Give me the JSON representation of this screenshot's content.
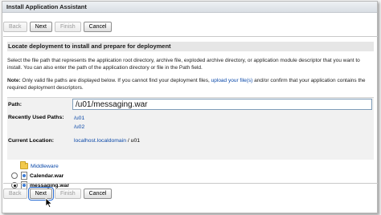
{
  "window": {
    "title": "Install Application Assistant"
  },
  "nav_buttons": {
    "back": "Back",
    "next": "Next",
    "finish": "Finish",
    "cancel": "Cancel"
  },
  "section": {
    "header": "Locate deployment to install and prepare for deployment",
    "description": "Select the file path that represents the application root directory, archive file, exploded archive directory, or application module descriptor that you want to install. You can also enter the path of the application directory or file in the Path field.",
    "note_label": "Note:",
    "note_text_before": " Only valid file paths are displayed below. If you cannot find your deployment files, ",
    "note_link": "upload your file(s)",
    "note_text_after": " and/or confirm that your application contains the required deployment descriptors."
  },
  "form": {
    "path_label": "Path:",
    "path_value": "/u01/messaging.war",
    "recent_label": "Recently Used Paths:",
    "recent_paths": [
      "/u01",
      "/u02"
    ],
    "current_label": "Current Location:",
    "current_host": "localhost.localdomain",
    "current_separator": " / ",
    "current_dir": "u01"
  },
  "file_tree": {
    "folder": {
      "name": "Middleware",
      "icon": "folder-icon"
    },
    "files": [
      {
        "name": "Calendar.war",
        "selected": false
      },
      {
        "name": "messaging.war",
        "selected": true
      }
    ]
  },
  "colors": {
    "link": "#0a48a8",
    "section_header_bg": "#e6e6e6",
    "form_panel_bg": "#f1f1f1"
  }
}
